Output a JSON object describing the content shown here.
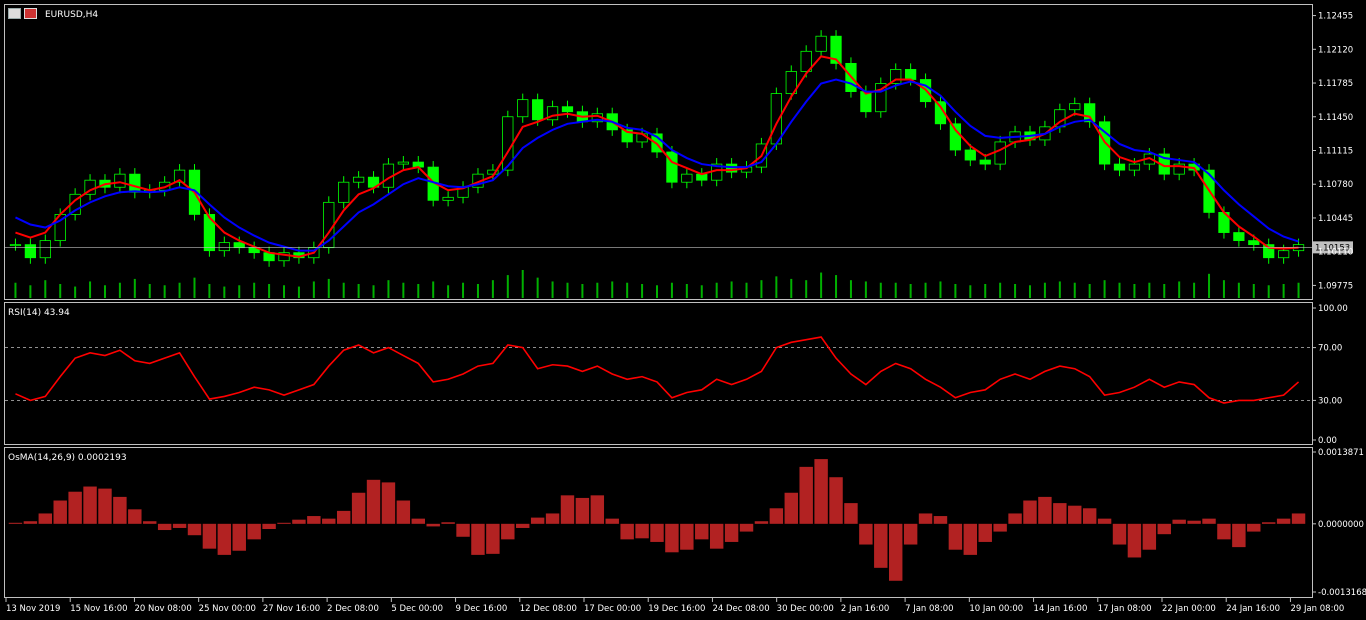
{
  "symbol_title": "EURUSD,H4",
  "colors": {
    "background": "#000000",
    "grid_frame": "#c0c0c0",
    "candle_bull": "#00ff00",
    "candle_bear": "#00ff00",
    "ma_fast": "#ff0000",
    "ma_slow": "#0000ff",
    "volume": "#00b000",
    "rsi_line": "#ff0000",
    "osma_bars": "#b22222",
    "current_price_bg": "#c0c0c0"
  },
  "icons": [
    "chart-window-icon",
    "flag-eu-icon"
  ],
  "chart_data": [
    {
      "type": "line",
      "name": "price",
      "ylim": [
        1.0965,
        1.1255
      ],
      "y_ticks": [
        "1.12455",
        "1.12120",
        "1.11785",
        "1.11450",
        "1.11115",
        "1.10780",
        "1.10445",
        "1.10110",
        "1.09775"
      ],
      "y_tick_values": [
        1.12455,
        1.1212,
        1.11785,
        1.1145,
        1.11115,
        1.1078,
        1.10445,
        1.1011,
        1.09775
      ],
      "current_price": "1.10153",
      "close": [
        1.1018,
        1.1005,
        1.1022,
        1.1048,
        1.1068,
        1.1082,
        1.1075,
        1.1088,
        1.107,
        1.1072,
        1.108,
        1.1092,
        1.1048,
        1.1012,
        1.102,
        1.1015,
        1.101,
        1.1002,
        1.101,
        1.1005,
        1.1015,
        1.106,
        1.108,
        1.1085,
        1.1075,
        1.1098,
        1.11,
        1.1095,
        1.1062,
        1.1065,
        1.1075,
        1.1088,
        1.1092,
        1.1145,
        1.1162,
        1.1142,
        1.1155,
        1.115,
        1.114,
        1.1148,
        1.1132,
        1.112,
        1.1128,
        1.111,
        1.108,
        1.1088,
        1.1082,
        1.1098,
        1.109,
        1.1095,
        1.1118,
        1.1168,
        1.119,
        1.121,
        1.1225,
        1.1198,
        1.117,
        1.115,
        1.1178,
        1.1192,
        1.1182,
        1.116,
        1.1138,
        1.1112,
        1.1102,
        1.1098,
        1.112,
        1.113,
        1.1122,
        1.1135,
        1.1152,
        1.1158,
        1.114,
        1.1098,
        1.1092,
        1.1098,
        1.1108,
        1.1088,
        1.1098,
        1.1092,
        1.105,
        1.103,
        1.1022,
        1.1018,
        1.1005,
        1.1012,
        1.1018
      ],
      "series": [
        {
          "name": "",
          "values": [
            1.103,
            1.1025,
            1.103,
            1.1048,
            1.1062,
            1.1072,
            1.1078,
            1.108,
            1.1076,
            1.1072,
            1.1075,
            1.1082,
            1.107,
            1.1045,
            1.103,
            1.1022,
            1.1016,
            1.101,
            1.1008,
            1.1006,
            1.101,
            1.103,
            1.1052,
            1.1068,
            1.1074,
            1.1084,
            1.1092,
            1.1095,
            1.108,
            1.1072,
            1.1074,
            1.108,
            1.1086,
            1.111,
            1.1135,
            1.114,
            1.1146,
            1.1148,
            1.1145,
            1.1146,
            1.114,
            1.113,
            1.1128,
            1.1118,
            1.11,
            1.1094,
            1.1088,
            1.1092,
            1.1092,
            1.1094,
            1.1106,
            1.1138,
            1.1165,
            1.1188,
            1.1205,
            1.1202,
            1.1185,
            1.1168,
            1.1172,
            1.1182,
            1.1182,
            1.1172,
            1.1155,
            1.1132,
            1.1116,
            1.1106,
            1.1112,
            1.112,
            1.1122,
            1.1128,
            1.114,
            1.1148,
            1.1145,
            1.112,
            1.1105,
            1.11,
            1.1104,
            1.1096,
            1.1096,
            1.1094,
            1.1072,
            1.105,
            1.1036,
            1.1026,
            1.1015,
            1.1014,
            1.1015
          ]
        },
        {
          "name": "",
          "values": [
            1.1045,
            1.1038,
            1.1035,
            1.1042,
            1.1052,
            1.106,
            1.1066,
            1.107,
            1.1071,
            1.107,
            1.1071,
            1.1075,
            1.1072,
            1.1058,
            1.1045,
            1.1035,
            1.1027,
            1.102,
            1.1016,
            1.1012,
            1.1012,
            1.1022,
            1.1036,
            1.105,
            1.1058,
            1.1068,
            1.1078,
            1.1084,
            1.108,
            1.1076,
            1.1075,
            1.1078,
            1.1082,
            1.1096,
            1.1114,
            1.1124,
            1.1132,
            1.1138,
            1.114,
            1.1142,
            1.114,
            1.1134,
            1.1132,
            1.1125,
            1.1112,
            1.1104,
            1.1098,
            1.1096,
            1.1095,
            1.1095,
            1.11,
            1.1118,
            1.114,
            1.116,
            1.1178,
            1.1182,
            1.1178,
            1.117,
            1.117,
            1.1176,
            1.118,
            1.1176,
            1.1166,
            1.115,
            1.1136,
            1.1126,
            1.1124,
            1.1125,
            1.1126,
            1.1128,
            1.1135,
            1.114,
            1.1142,
            1.113,
            1.1118,
            1.1112,
            1.111,
            1.1104,
            1.1102,
            1.11,
            1.1088,
            1.1072,
            1.1058,
            1.1046,
            1.1034,
            1.1026,
            1.1021
          ]
        }
      ],
      "volume": [
        12,
        10,
        14,
        11,
        9,
        13,
        10,
        12,
        15,
        11,
        10,
        12,
        16,
        11,
        9,
        10,
        12,
        11,
        10,
        9,
        13,
        15,
        12,
        11,
        10,
        14,
        12,
        11,
        13,
        10,
        12,
        11,
        14,
        18,
        22,
        16,
        13,
        12,
        11,
        12,
        13,
        12,
        11,
        10,
        12,
        11,
        10,
        12,
        13,
        12,
        14,
        17,
        15,
        14,
        20,
        18,
        14,
        13,
        12,
        12,
        11,
        12,
        13,
        11,
        10,
        11,
        12,
        11,
        10,
        12,
        13,
        12,
        11,
        14,
        12,
        11,
        12,
        11,
        13,
        12,
        19,
        14,
        12,
        11,
        10,
        11,
        12
      ]
    },
    {
      "type": "line",
      "title": "RSI(14) 43.94",
      "ylim": [
        0,
        100
      ],
      "levels": [
        70,
        30
      ],
      "y_ticks": [
        "100.00",
        "70.00",
        "30.00",
        "0.00"
      ],
      "y_tick_values": [
        100,
        70,
        30,
        0
      ],
      "series": [
        {
          "name": "RSI(14)",
          "values": [
            35,
            30,
            33,
            48,
            62,
            66,
            64,
            68,
            60,
            58,
            62,
            66,
            48,
            31,
            33,
            36,
            40,
            38,
            34,
            38,
            42,
            56,
            68,
            72,
            66,
            70,
            64,
            58,
            44,
            46,
            50,
            56,
            58,
            72,
            70,
            54,
            57,
            56,
            52,
            56,
            50,
            46,
            48,
            44,
            32,
            36,
            38,
            46,
            42,
            46,
            52,
            70,
            74,
            76,
            78,
            62,
            50,
            42,
            52,
            58,
            54,
            46,
            40,
            32,
            36,
            38,
            46,
            50,
            46,
            52,
            56,
            54,
            48,
            34,
            36,
            40,
            46,
            40,
            44,
            42,
            32,
            28,
            30,
            30,
            32,
            34,
            44
          ]
        }
      ]
    },
    {
      "type": "bar",
      "title": "OsMA(14,26,9) 0.0002193",
      "ylim": [
        -0.0013168,
        0.0013871
      ],
      "y_ticks": [
        "0.0013871",
        "0.0000000",
        "-0.0013168"
      ],
      "y_tick_values": [
        0.0013871,
        0.0,
        -0.0013168
      ],
      "values": [
        2e-05,
        5e-05,
        0.0002,
        0.00045,
        0.00062,
        0.00072,
        0.00068,
        0.00052,
        0.00028,
        5e-05,
        -0.00012,
        -8e-05,
        -0.00022,
        -0.00048,
        -0.0006,
        -0.00052,
        -0.0003,
        -0.0001,
        2e-05,
        8e-05,
        0.00015,
        0.0001,
        0.00025,
        0.0006,
        0.00085,
        0.0008,
        0.00045,
        0.0001,
        -5e-05,
        3e-05,
        -0.00025,
        -0.0006,
        -0.00058,
        -0.0003,
        -8e-05,
        0.00012,
        0.0002,
        0.00055,
        0.0005,
        0.00055,
        0.0001,
        -0.0003,
        -0.00028,
        -0.00035,
        -0.00055,
        -0.0005,
        -0.0003,
        -0.00048,
        -0.00035,
        -0.00015,
        5e-05,
        0.0003,
        0.0006,
        0.0011,
        0.00125,
        0.0009,
        0.0004,
        -0.0004,
        -0.00085,
        -0.0011,
        -0.0004,
        0.0002,
        0.00015,
        -0.0005,
        -0.0006,
        -0.00035,
        -0.00015,
        0.0002,
        0.00045,
        0.00052,
        0.0004,
        0.00035,
        0.0003,
        0.0001,
        -0.0004,
        -0.00065,
        -0.0005,
        -0.0002,
        8e-05,
        6e-05,
        0.0001,
        -0.0003,
        -0.00045,
        -0.00015,
        3e-05,
        0.0001,
        0.0002
      ]
    }
  ],
  "time_axis": [
    "13 Nov 2019",
    "15 Nov 16:00",
    "20 Nov 08:00",
    "25 Nov 00:00",
    "27 Nov 16:00",
    "2 Dec 08:00",
    "5 Dec 00:00",
    "9 Dec 16:00",
    "12 Dec 08:00",
    "17 Dec 00:00",
    "19 Dec 16:00",
    "24 Dec 08:00",
    "30 Dec 00:00",
    "2 Jan 16:00",
    "7 Jan 08:00",
    "10 Jan 00:00",
    "14 Jan 16:00",
    "17 Jan 08:00",
    "22 Jan 00:00",
    "24 Jan 16:00",
    "29 Jan 08:00"
  ]
}
